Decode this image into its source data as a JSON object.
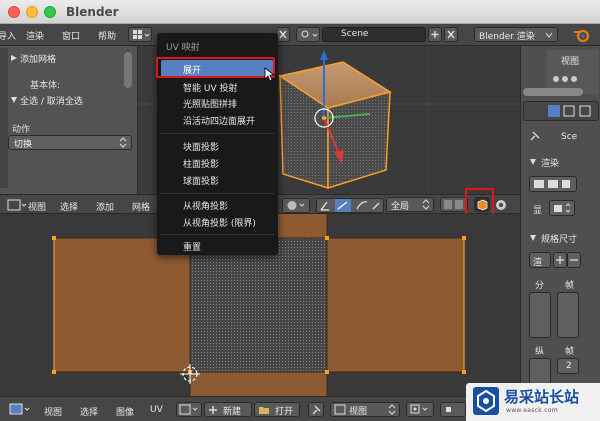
{
  "window": {
    "title": "Blender"
  },
  "info_menu": {
    "items": [
      "导入",
      "渲染",
      "窗口",
      "帮助"
    ],
    "scene": "Scene",
    "engine": "Blender 渲染"
  },
  "tool_shelf": {
    "panel_add_mesh": "添加网格",
    "basic_label": "基本体:",
    "panel_select": "全选 / 取消全选",
    "action_label": "动作",
    "action_value": "切换"
  },
  "uv_menu": {
    "title": "UV 映射",
    "items": [
      "展开",
      "智能 UV 投射",
      "光照贴图拼排",
      "沿活动四边面展开",
      "块面投影",
      "柱面投影",
      "球面投影",
      "从视角投影",
      "从视角投影 (限界)",
      "重置"
    ]
  },
  "viewport_header": {
    "items": [
      "视图",
      "选择",
      "添加",
      "网格"
    ],
    "global": "全局"
  },
  "uv_footer": {
    "items": [
      "视图",
      "选择",
      "图像",
      "UV"
    ],
    "new_label": "新建",
    "open_label": "打开",
    "view_select": "视图"
  },
  "properties": {
    "view_label": "视图",
    "sce_label": "Sce",
    "render_panel": "渲染",
    "display_label": "显",
    "dimensions_panel": "规格尺寸",
    "render_preset": "渲",
    "col_a": "分",
    "col_b": "帧",
    "col_c": "纵",
    "col_d": "帧",
    "frame_value": "2"
  },
  "watermark": {
    "name": "易采站长站",
    "url": "www.easck.com"
  },
  "colors": {
    "highlight": "#5680c2",
    "annotation": "#e0151b",
    "uv_face": "#8d5a32",
    "selection": "#ff9f2a"
  }
}
